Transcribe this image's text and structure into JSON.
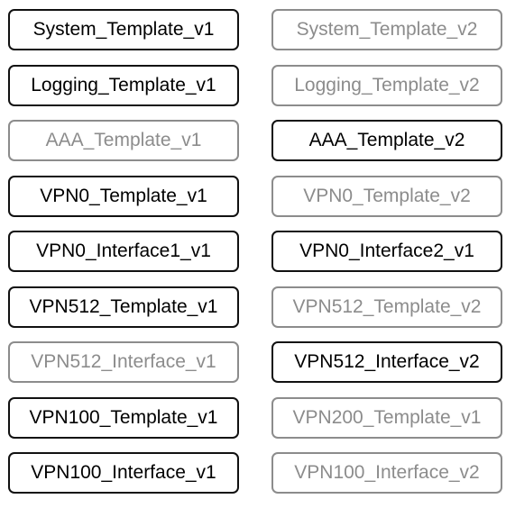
{
  "templates": {
    "left": [
      {
        "label": "System_Template_v1",
        "active": true
      },
      {
        "label": "Logging_Template_v1",
        "active": true
      },
      {
        "label": "AAA_Template_v1",
        "active": false
      },
      {
        "label": "VPN0_Template_v1",
        "active": true
      },
      {
        "label": "VPN0_Interface1_v1",
        "active": true
      },
      {
        "label": "VPN512_Template_v1",
        "active": true
      },
      {
        "label": "VPN512_Interface_v1",
        "active": false
      },
      {
        "label": "VPN100_Template_v1",
        "active": true
      },
      {
        "label": "VPN100_Interface_v1",
        "active": true
      }
    ],
    "right": [
      {
        "label": "System_Template_v2",
        "active": false
      },
      {
        "label": "Logging_Template_v2",
        "active": false
      },
      {
        "label": "AAA_Template_v2",
        "active": true
      },
      {
        "label": "VPN0_Template_v2",
        "active": false
      },
      {
        "label": "VPN0_Interface2_v1",
        "active": true
      },
      {
        "label": "VPN512_Template_v2",
        "active": false
      },
      {
        "label": "VPN512_Interface_v2",
        "active": true
      },
      {
        "label": "VPN200_Template_v1",
        "active": false
      },
      {
        "label": "VPN100_Interface_v2",
        "active": false
      }
    ]
  },
  "colors": {
    "active_border": "#111111",
    "inactive_border": "#8c8c8c"
  }
}
